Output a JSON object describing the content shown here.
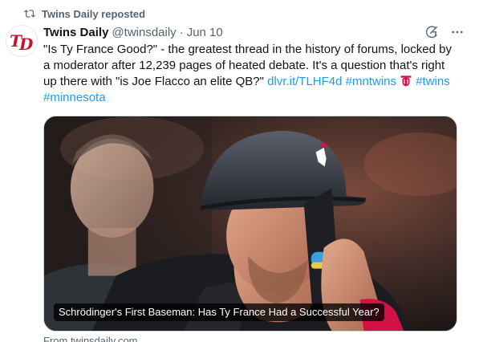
{
  "repost": {
    "label": "Twins Daily reposted",
    "icon": "repost-icon"
  },
  "avatar": {
    "text": "TD",
    "color": "#c8102e"
  },
  "header": {
    "author": "Twins Daily",
    "handle": "@twinsdaily",
    "separator": "·",
    "time": "Jun 10",
    "grok_icon": "grok-icon",
    "more_icon": "more-icon"
  },
  "tweet": {
    "text": "\"Is Ty France Good?\" - the greatest thread in the history of forums, locked by a moderator after 12,239 pages of heated debate. It's a question that's right up there with \"is Joe Flacco an elite QB?\" ",
    "link": "dlvr.it/TLHF4d",
    "hashtag1": "#mntwins",
    "hashtag2": "#twins",
    "hashtag3": "#minnesota",
    "twins_logo_icon": "twins-logo-icon"
  },
  "card": {
    "caption": "Schrödinger's First Baseman: Has Ty France Had a Successful Year?",
    "source": "From twinsdaily.com"
  },
  "colors": {
    "link": "#1d9bf0",
    "muted": "#536471",
    "twins_red": "#d31145"
  }
}
